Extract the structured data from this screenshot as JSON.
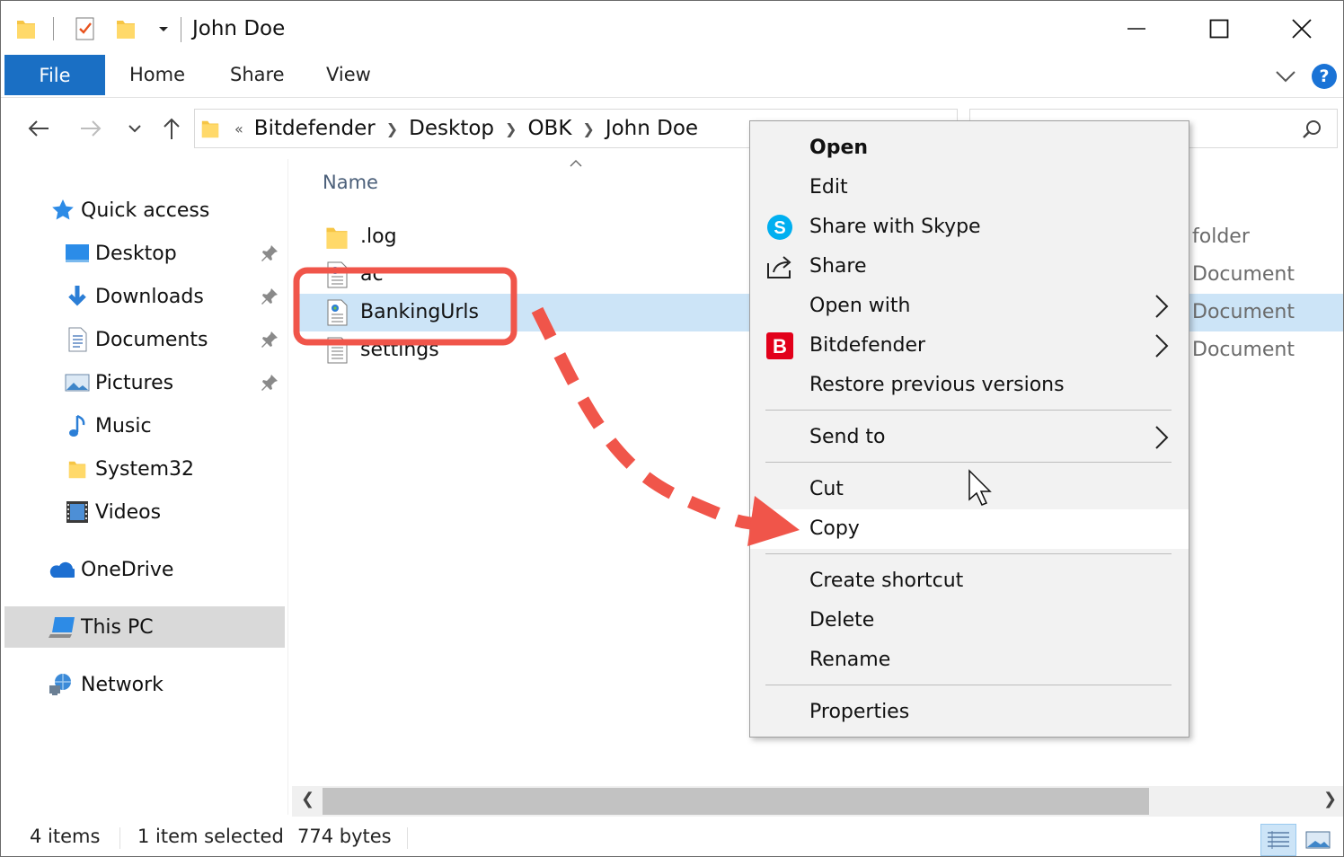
{
  "window": {
    "title": "John Doe",
    "controls": {
      "minimize": "minimize",
      "maximize": "maximize",
      "close": "close"
    }
  },
  "ribbon": {
    "tabs": [
      "File",
      "Home",
      "Share",
      "View"
    ],
    "help": "?"
  },
  "address": {
    "overflow": "«",
    "crumbs": [
      "Bitdefender",
      "Desktop",
      "OBK",
      "John Doe"
    ]
  },
  "sidebar": {
    "quick_access": "Quick access",
    "items": [
      {
        "label": "Desktop",
        "icon": "desktop-icon",
        "pinned": true
      },
      {
        "label": "Downloads",
        "icon": "downloads-icon",
        "pinned": true
      },
      {
        "label": "Documents",
        "icon": "documents-icon",
        "pinned": true
      },
      {
        "label": "Pictures",
        "icon": "pictures-icon",
        "pinned": true
      },
      {
        "label": "Music",
        "icon": "music-icon",
        "pinned": false
      },
      {
        "label": "System32",
        "icon": "folder-icon",
        "pinned": false
      },
      {
        "label": "Videos",
        "icon": "videos-icon",
        "pinned": false
      }
    ],
    "onedrive": "OneDrive",
    "this_pc": "This PC",
    "network": "Network"
  },
  "files": {
    "column_name": "Name",
    "rows": [
      {
        "name": ".log",
        "type": "folder",
        "icon": "folder-icon",
        "selected": false
      },
      {
        "name": "ac",
        "type": "Document",
        "icon": "file-icon",
        "selected": false
      },
      {
        "name": "BankingUrls",
        "type": "Document",
        "icon": "file-icon",
        "selected": true
      },
      {
        "name": "settings",
        "type": "Document",
        "icon": "file-icon",
        "selected": false
      }
    ]
  },
  "context_menu": {
    "items": {
      "open": "Open",
      "edit": "Edit",
      "share_skype": "Share with Skype",
      "share": "Share",
      "open_with": "Open with",
      "bitdefender": "Bitdefender",
      "restore": "Restore previous versions",
      "send_to": "Send to",
      "cut": "Cut",
      "copy": "Copy",
      "create_shortcut": "Create shortcut",
      "delete": "Delete",
      "rename": "Rename",
      "properties": "Properties"
    },
    "highlighted": "Copy"
  },
  "status": {
    "count": "4 items",
    "selection": "1 item selected",
    "size": "774 bytes"
  },
  "colors": {
    "accent": "#1a6fc4",
    "selection": "#cce4f7",
    "annotation": "#f0554a",
    "bitdefender": "#e2001a",
    "skype": "#00aff0"
  }
}
